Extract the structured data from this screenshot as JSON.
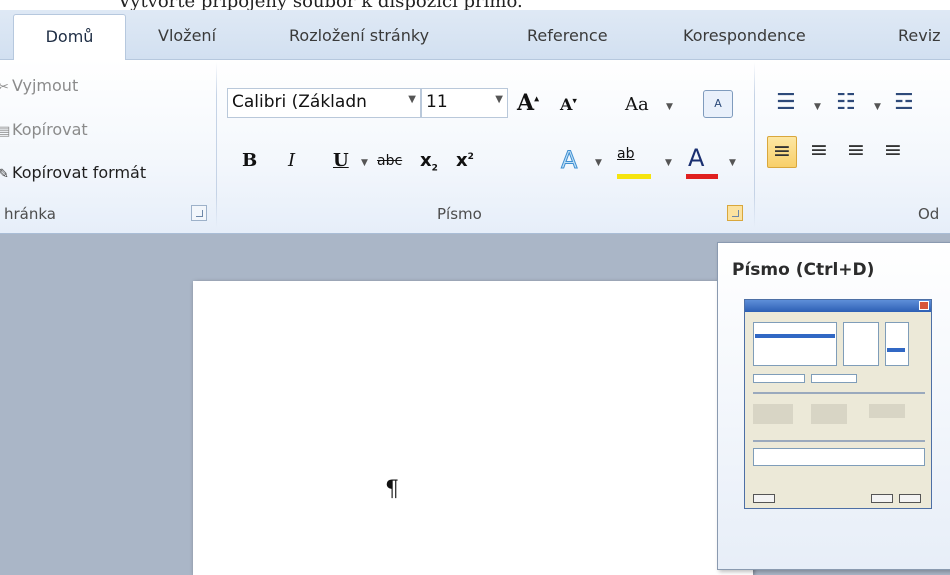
{
  "tabs": [
    {
      "label": "Domů",
      "active": true
    },
    {
      "label": "Vložení",
      "active": false
    },
    {
      "label": "Rozložení stránky",
      "active": false
    },
    {
      "label": "Reference",
      "active": false
    },
    {
      "label": "Korespondence",
      "active": false
    },
    {
      "label": "Reviz",
      "active": false
    }
  ],
  "clipboard": {
    "cut_label": "Vyjmout",
    "copy_label": "Kopírovat",
    "format_painter_label": "Kopírovat formát",
    "group_label": "hránka"
  },
  "font": {
    "font_name": "Calibri (Základn",
    "font_size": "11",
    "grow_label": "A",
    "shrink_label": "A",
    "change_case_label": "Aa",
    "bold": "B",
    "italic": "I",
    "underline": "U",
    "strikethrough": "abc",
    "subscript": "x",
    "superscript": "x",
    "text_effects": "A",
    "highlight": "ab",
    "font_color": "A",
    "group_label": "Písmo",
    "highlight_color": "#f5e40f",
    "font_color_value": "#e02020"
  },
  "paragraph": {
    "group_label": "Od"
  },
  "tooltip": {
    "title": "Písmo (Ctrl+D)"
  },
  "document": {
    "mark": "¶"
  }
}
